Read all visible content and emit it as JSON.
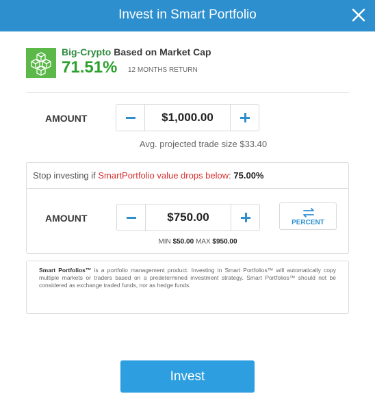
{
  "header": {
    "title": "Invest in Smart Portfolio",
    "close_icon": "close-icon"
  },
  "portfolio": {
    "name": "Big-Crypto",
    "subtitle": "Based on Market Cap",
    "return_value": "71.51%",
    "return_label": "12 MONTHS RETURN",
    "icon": "cubes-icon"
  },
  "amount": {
    "label": "AMOUNT",
    "value": "$1,000.00",
    "avg_note": "Avg. projected trade size $33.40"
  },
  "stop_loss": {
    "prefix": "Stop investing if ",
    "highlight": "SmartPortfolio value drops below",
    "colon": ": ",
    "percent": "75.00%",
    "amount_label": "AMOUNT",
    "amount_value": "$750.00",
    "toggle_label": "PERCENT",
    "min_label": "MIN",
    "min_value": "$50.00",
    "max_label": "MAX",
    "max_value": "$950.00"
  },
  "disclaimer": {
    "brand": "Smart Portfolios™",
    "text": " is a portfolio management product. Investing in Smart Portfolios™ will automatically copy multiple markets or traders based on a predetermined investment strategy. Smart Portfolios™ should not be considered as exchange traded funds, nor as hedge funds."
  },
  "invest_button": {
    "label": "Invest"
  },
  "colors": {
    "header": "#2d8fce",
    "accent_green": "#2da12d",
    "stop_red": "#d93030",
    "button": "#2d9ee0"
  }
}
